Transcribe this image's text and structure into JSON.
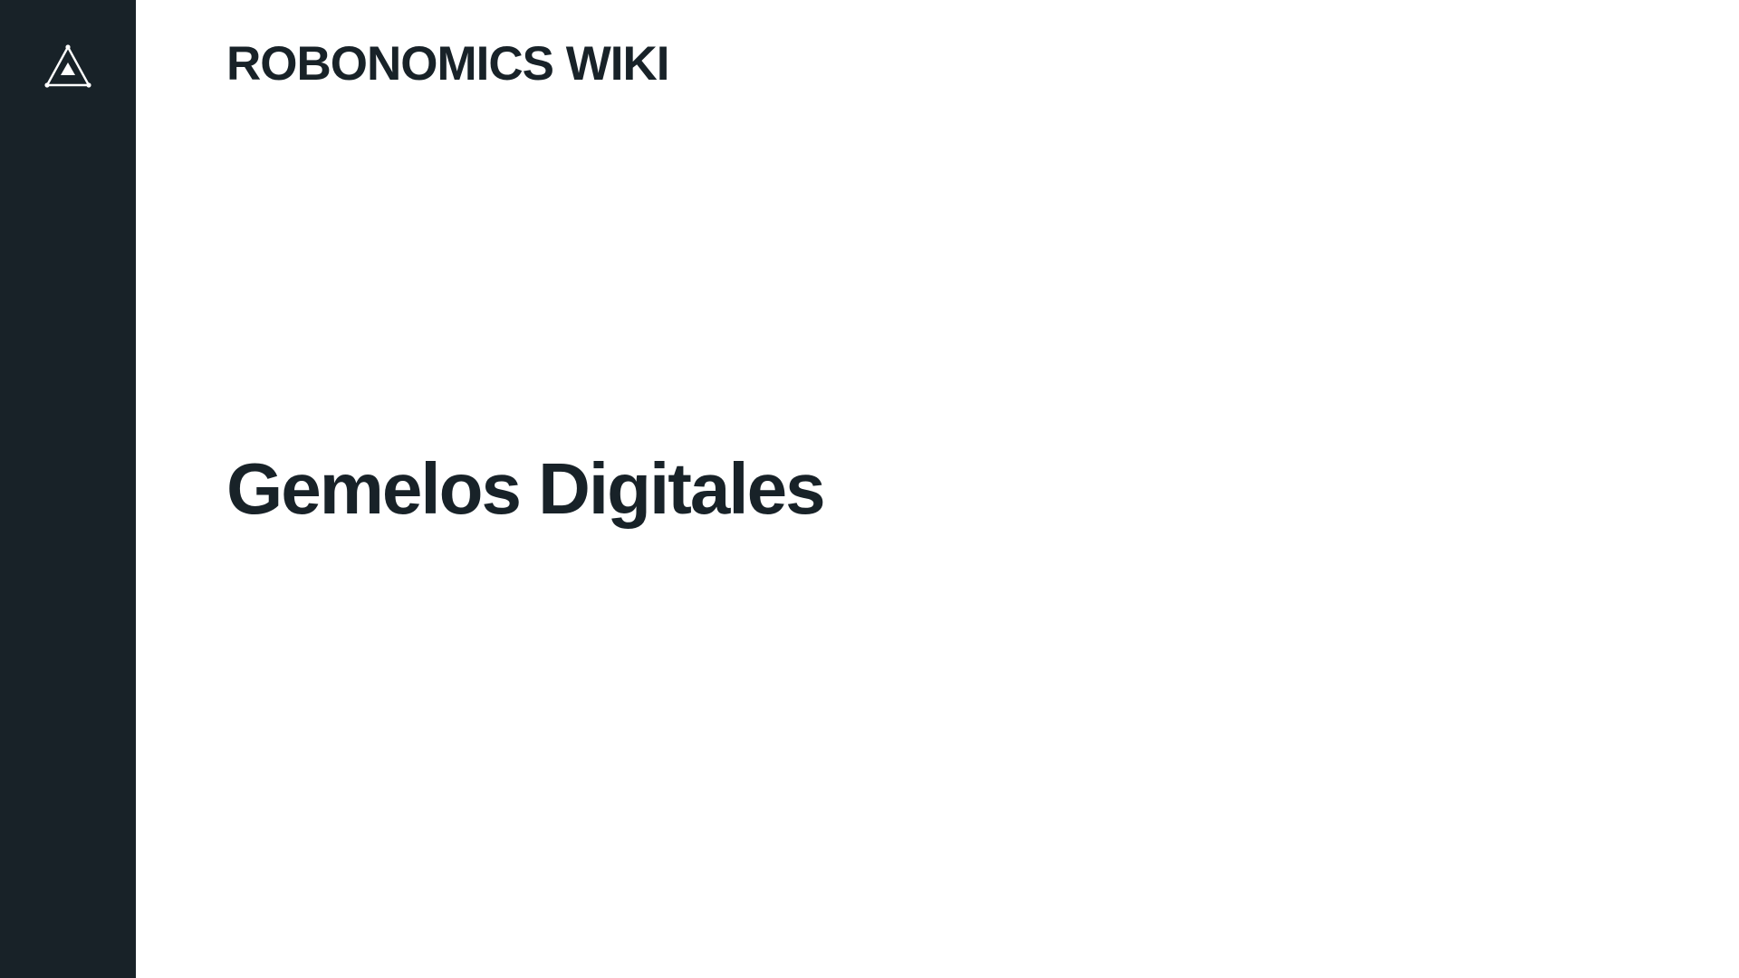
{
  "sidebar": {
    "logo_icon": "robonomics-triangle-logo-icon",
    "background_color": "#182228",
    "logo_color": "#ffffff"
  },
  "header": {
    "site_title": "ROBONOMICS WIKI"
  },
  "main": {
    "page_title": "Gemelos Digitales"
  },
  "colors": {
    "text": "#182228",
    "background": "#ffffff"
  }
}
